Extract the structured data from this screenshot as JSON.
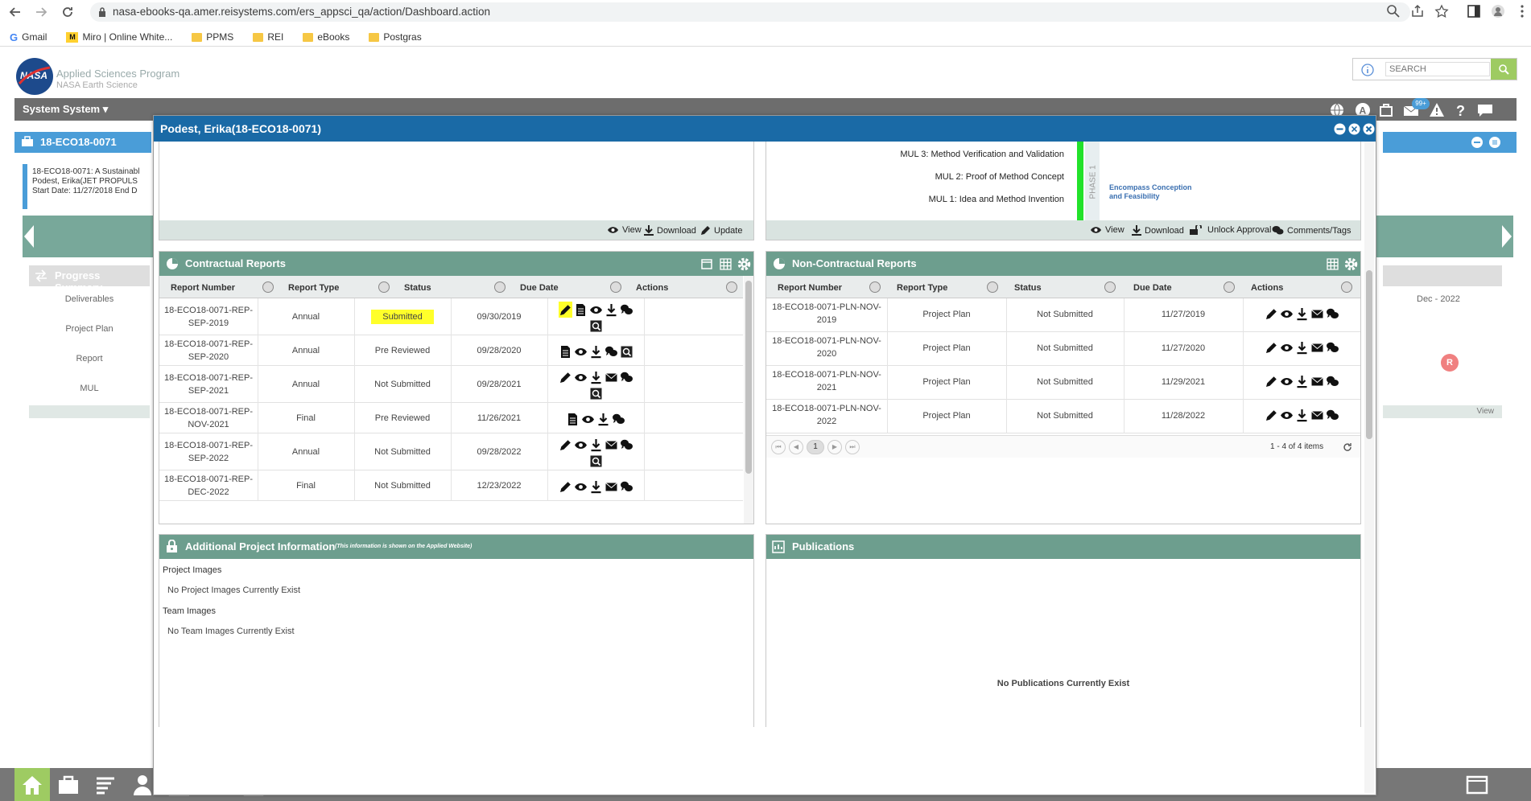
{
  "browser": {
    "url": "nasa-ebooks-qa.amer.reisystems.com/ers_appsci_qa/action/Dashboard.action",
    "bookmarks": [
      "Gmail",
      "Miro | Online White...",
      "PPMS",
      "REI",
      "eBooks",
      "Postgras"
    ]
  },
  "app": {
    "title": "Applied Sciences Program",
    "subtitle": "NASA Earth Science",
    "logo_text": "NASA",
    "search_placeholder": "SEARCH",
    "system_menu": "System System",
    "badge_count": "99+"
  },
  "background": {
    "project_tab": "18-ECO18-0071",
    "project_info_lines": [
      "18-ECO18-0071: A Sustainabl",
      "Podest, Erika(JET PROPULS",
      "Start Date: 11/27/2018 End D"
    ],
    "progress_summary": "Progress Summary",
    "progress_rows": [
      "Deliverables",
      "Project Plan",
      "Report",
      "MUL"
    ],
    "right_col_header": "Dec - 2022",
    "right_badge": "R",
    "right_view": "View"
  },
  "modal": {
    "title": "Podest, Erika(18-ECO18-0071)",
    "top_left_toolbar": [
      "View",
      "Download",
      "Update"
    ],
    "mul": {
      "levels": [
        "MUL 3: Method Verification and Validation",
        "MUL 2: Proof of Method Concept",
        "MUL 1: Idea and Method Invention"
      ],
      "phase_label": "PHASE 1",
      "phase_desc": [
        "Encompass Conception",
        "and Feasibility"
      ],
      "toolbar": [
        "View",
        "Download",
        "Unlock Approval",
        "Comments/Tags"
      ]
    },
    "contractual": {
      "title": "Contractual Reports",
      "columns": [
        "Report Number",
        "Report Type",
        "Status",
        "Due Date",
        "Actions"
      ],
      "rows": [
        {
          "num1": "18-ECO18-0071-REP-",
          "num2": "SEP-2019",
          "type": "Annual",
          "status": "Submitted",
          "due": "09/30/2019"
        },
        {
          "num1": "18-ECO18-0071-REP-",
          "num2": "SEP-2020",
          "type": "Annual",
          "status": "Pre Reviewed",
          "due": "09/28/2020"
        },
        {
          "num1": "18-ECO18-0071-REP-",
          "num2": "SEP-2021",
          "type": "Annual",
          "status": "Not Submitted",
          "due": "09/28/2021"
        },
        {
          "num1": "18-ECO18-0071-REP-",
          "num2": "NOV-2021",
          "type": "Final",
          "status": "Pre Reviewed",
          "due": "11/26/2021"
        },
        {
          "num1": "18-ECO18-0071-REP-",
          "num2": "SEP-2022",
          "type": "Annual",
          "status": "Not Submitted",
          "due": "09/28/2022"
        },
        {
          "num1": "18-ECO18-0071-REP-",
          "num2": "DEC-2022",
          "type": "Final",
          "status": "Not Submitted",
          "due": "12/23/2022"
        }
      ]
    },
    "noncontractual": {
      "title": "Non-Contractual Reports",
      "columns": [
        "Report Number",
        "Report Type",
        "Status",
        "Due Date",
        "Actions"
      ],
      "rows": [
        {
          "num1": "18-ECO18-0071-PLN-NOV-",
          "num2": "2019",
          "type": "Project Plan",
          "status": "Not Submitted",
          "due": "11/27/2019"
        },
        {
          "num1": "18-ECO18-0071-PLN-NOV-",
          "num2": "2020",
          "type": "Project Plan",
          "status": "Not Submitted",
          "due": "11/27/2020"
        },
        {
          "num1": "18-ECO18-0071-PLN-NOV-",
          "num2": "2021",
          "type": "Project Plan",
          "status": "Not Submitted",
          "due": "11/29/2021"
        },
        {
          "num1": "18-ECO18-0071-PLN-NOV-",
          "num2": "2022",
          "type": "Project Plan",
          "status": "Not Submitted",
          "due": "11/28/2022"
        }
      ],
      "pager_page": "1",
      "pager_info": "1 - 4 of 4 items"
    },
    "additional": {
      "title": "Additional Project Information",
      "note": "(This information is shown on the Applied Website)",
      "images_label": "Project Images",
      "images_empty": "No Project Images Currently Exist",
      "team_label": "Team Images",
      "team_empty": "No Team Images Currently Exist"
    },
    "publications": {
      "title": "Publications",
      "empty": "No Publications Currently Exist"
    }
  },
  "colors": {
    "modal_header": "#1a6aa6",
    "panel_header": "#6d9e8e",
    "highlight": "#ffff2a",
    "phase_bar": "#22e22a"
  }
}
